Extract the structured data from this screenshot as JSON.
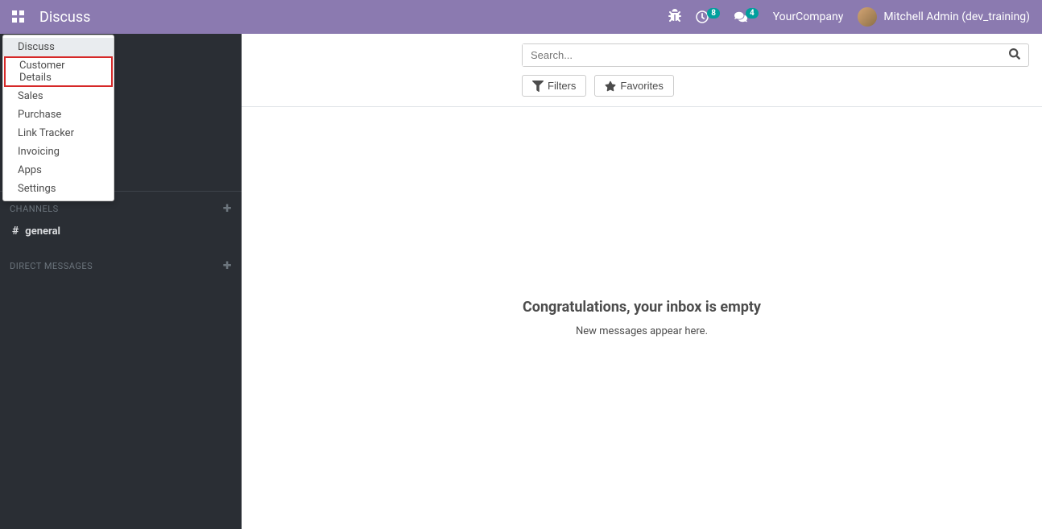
{
  "header": {
    "app_title": "Discuss",
    "badge_activity": "8",
    "badge_messages": "4",
    "company_name": "YourCompany",
    "user_name": "Mitchell Admin (dev_training)"
  },
  "dropdown": {
    "items": [
      {
        "label": "Discuss",
        "active": true,
        "highlighted": false
      },
      {
        "label": "Customer Details",
        "active": false,
        "highlighted": true
      },
      {
        "label": "Sales",
        "active": false,
        "highlighted": false
      },
      {
        "label": "Purchase",
        "active": false,
        "highlighted": false
      },
      {
        "label": "Link Tracker",
        "active": false,
        "highlighted": false
      },
      {
        "label": "Invoicing",
        "active": false,
        "highlighted": false
      },
      {
        "label": "Apps",
        "active": false,
        "highlighted": false
      },
      {
        "label": "Settings",
        "active": false,
        "highlighted": false
      }
    ]
  },
  "sidebar": {
    "channels_header": "CHANNELS",
    "channel_name": "general",
    "direct_messages_header": "DIRECT MESSAGES"
  },
  "toolbar": {
    "search_placeholder": "Search...",
    "filters_label": "Filters",
    "favorites_label": "Favorites"
  },
  "content": {
    "empty_title": "Congratulations, your inbox is empty",
    "empty_subtitle": "New messages appear here."
  }
}
